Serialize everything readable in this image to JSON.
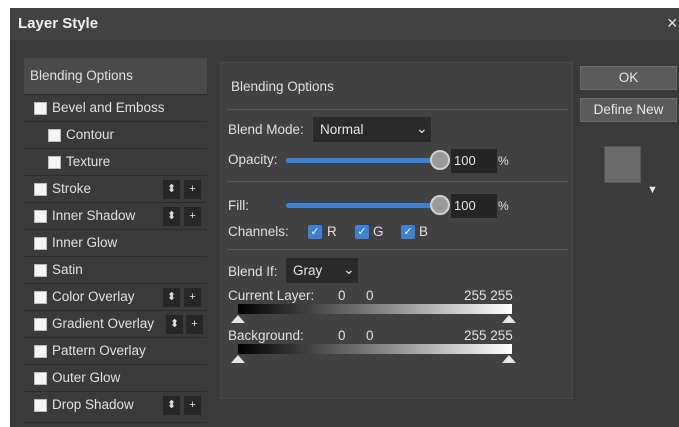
{
  "window": {
    "title": "Layer Style",
    "close_glyph": "×"
  },
  "styles_list": {
    "items": [
      {
        "label": "Blending Options",
        "checkbox": false,
        "add": false,
        "indent": false
      },
      {
        "label": "Bevel and Emboss",
        "checkbox": true,
        "add": false,
        "indent": false
      },
      {
        "label": "Contour",
        "checkbox": true,
        "add": false,
        "indent": true
      },
      {
        "label": "Texture",
        "checkbox": true,
        "add": false,
        "indent": true
      },
      {
        "label": "Stroke",
        "checkbox": true,
        "add": true,
        "indent": false
      },
      {
        "label": "Inner Shadow",
        "checkbox": true,
        "add": true,
        "indent": false
      },
      {
        "label": "Inner Glow",
        "checkbox": true,
        "add": false,
        "indent": false
      },
      {
        "label": "Satin",
        "checkbox": true,
        "add": false,
        "indent": false
      },
      {
        "label": "Color Overlay",
        "checkbox": true,
        "add": true,
        "indent": false
      },
      {
        "label": "Gradient Overlay",
        "checkbox": true,
        "add": true,
        "indent": false
      },
      {
        "label": "Pattern Overlay",
        "checkbox": true,
        "add": false,
        "indent": false
      },
      {
        "label": "Outer Glow",
        "checkbox": true,
        "add": false,
        "indent": false
      },
      {
        "label": "Drop Shadow",
        "checkbox": true,
        "add": true,
        "indent": false
      }
    ],
    "reorder_glyph": "⬍",
    "add_glyph": "+"
  },
  "blending": {
    "title": "Blending Options",
    "blend_mode": {
      "label": "Blend Mode:",
      "value": "Normal"
    },
    "opacity": {
      "label": "Opacity:",
      "value": "100",
      "unit": "%",
      "level": 1.0
    },
    "fill": {
      "label": "Fill:",
      "value": "100",
      "unit": "%",
      "level": 1.0
    },
    "channels": {
      "label": "Channels:",
      "r": "R",
      "g": "G",
      "b": "B"
    },
    "blend_if": {
      "label": "Blend If:",
      "value": "Gray"
    },
    "current_layer": {
      "label": "Current Layer:",
      "low1": "0",
      "low2": "0",
      "high": "255 255"
    },
    "background": {
      "label": "Background:",
      "low1": "0",
      "low2": "0",
      "high": "255 255"
    }
  },
  "buttons": {
    "ok": "OK",
    "define_new": "Define New"
  },
  "preview_menu_glyph": "▼",
  "dropdown_glyph": "⌄",
  "checkmark_glyph": "✓",
  "colors": {
    "accent": "#3b82d6",
    "dialog_bg": "#3a3a3a",
    "title_bg": "#424242"
  }
}
